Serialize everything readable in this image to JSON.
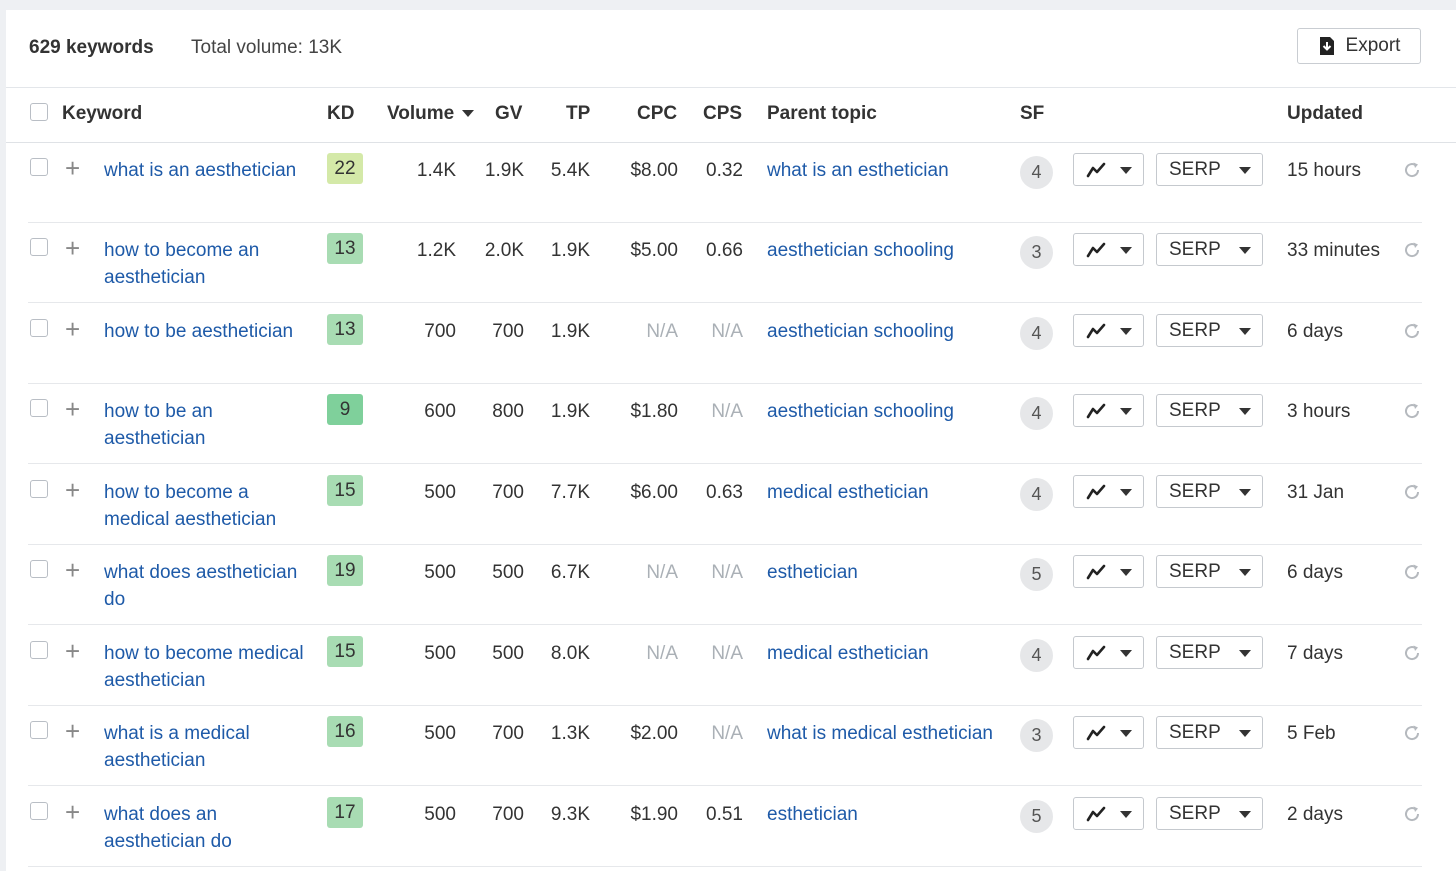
{
  "header": {
    "keyword_count": "629 keywords",
    "total_volume": "Total volume: 13K",
    "export_label": "Export"
  },
  "columns": {
    "keyword": "Keyword",
    "kd": "KD",
    "volume": "Volume",
    "gv": "GV",
    "tp": "TP",
    "cpc": "CPC",
    "cps": "CPS",
    "parent_topic": "Parent topic",
    "sf": "SF",
    "updated": "Updated"
  },
  "serp_label": "SERP",
  "icons": {
    "export": "download-icon",
    "add": "plus-icon",
    "trend": "trend-chart-icon",
    "dropdown": "caret-down-icon",
    "refresh": "refresh-icon",
    "sort": "sort-desc-icon"
  },
  "colors": {
    "link": "#1e5aa8",
    "kd_22": "#d4e9a8",
    "kd_low": "#a8dcb3",
    "kd_9": "#7fd09b"
  },
  "rows": [
    {
      "keyword": "what is an aesthetician",
      "kd": "22",
      "kd_color": "#d4e9a8",
      "volume": "1.4K",
      "gv": "1.9K",
      "tp": "5.4K",
      "cpc": "$8.00",
      "cps": "0.32",
      "parent": "what is an esthetician",
      "sf": "4",
      "updated": "15 hours"
    },
    {
      "keyword": "how to become an aesthetician",
      "kd": "13",
      "kd_color": "#a8dcb3",
      "volume": "1.2K",
      "gv": "2.0K",
      "tp": "1.9K",
      "cpc": "$5.00",
      "cps": "0.66",
      "parent": "aesthetician schooling",
      "sf": "3",
      "updated": "33 minutes"
    },
    {
      "keyword": "how to be aesthetician",
      "kd": "13",
      "kd_color": "#a8dcb3",
      "volume": "700",
      "gv": "700",
      "tp": "1.9K",
      "cpc": "N/A",
      "cps": "N/A",
      "parent": "aesthetician schooling",
      "sf": "4",
      "updated": "6 days"
    },
    {
      "keyword": "how to be an aesthetician",
      "kd": "9",
      "kd_color": "#7fd09b",
      "volume": "600",
      "gv": "800",
      "tp": "1.9K",
      "cpc": "$1.80",
      "cps": "N/A",
      "parent": "aesthetician schooling",
      "sf": "4",
      "updated": "3 hours"
    },
    {
      "keyword": "how to become a medical aesthetician",
      "kd": "15",
      "kd_color": "#a8dcb3",
      "volume": "500",
      "gv": "700",
      "tp": "7.7K",
      "cpc": "$6.00",
      "cps": "0.63",
      "parent": "medical esthetician",
      "sf": "4",
      "updated": "31 Jan"
    },
    {
      "keyword": "what does aesthetician do",
      "kd": "19",
      "kd_color": "#a8dcb3",
      "volume": "500",
      "gv": "500",
      "tp": "6.7K",
      "cpc": "N/A",
      "cps": "N/A",
      "parent": "esthetician",
      "sf": "5",
      "updated": "6 days"
    },
    {
      "keyword": "how to become medical aesthetician",
      "kd": "15",
      "kd_color": "#a8dcb3",
      "volume": "500",
      "gv": "500",
      "tp": "8.0K",
      "cpc": "N/A",
      "cps": "N/A",
      "parent": "medical esthetician",
      "sf": "4",
      "updated": "7 days"
    },
    {
      "keyword": "what is a medical aesthetician",
      "kd": "16",
      "kd_color": "#a8dcb3",
      "volume": "500",
      "gv": "700",
      "tp": "1.3K",
      "cpc": "$2.00",
      "cps": "N/A",
      "parent": "what is medical esthetician",
      "sf": "3",
      "updated": "5 Feb"
    },
    {
      "keyword": "what does an aesthetician do",
      "kd": "17",
      "kd_color": "#a8dcb3",
      "volume": "500",
      "gv": "700",
      "tp": "9.3K",
      "cpc": "$1.90",
      "cps": "0.51",
      "parent": "esthetician",
      "sf": "5",
      "updated": "2 days"
    }
  ]
}
